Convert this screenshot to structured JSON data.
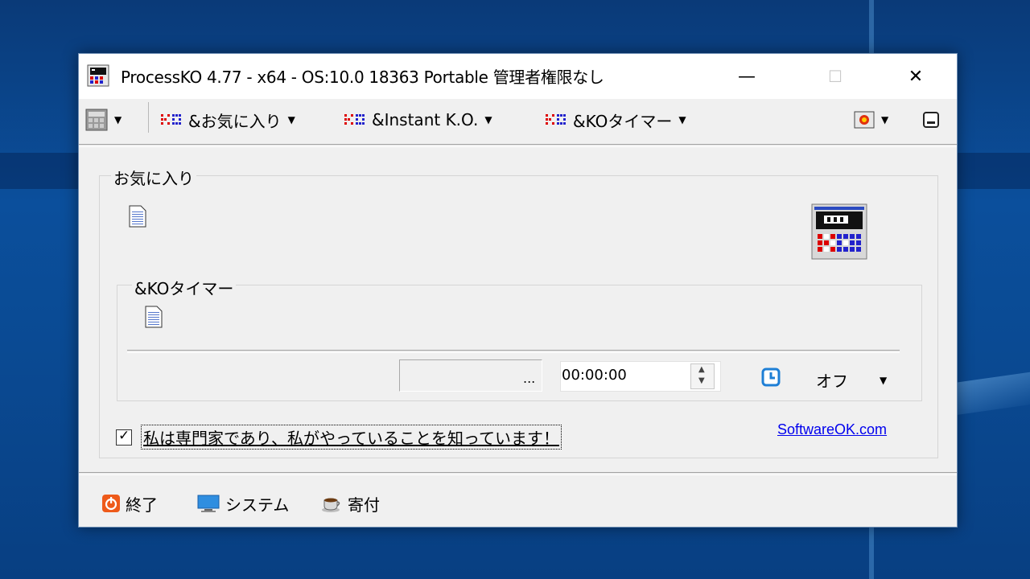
{
  "window": {
    "title": "ProcessKO 4.77 - x64  - OS:10.0 18363 Portable 管理者権限なし",
    "minimize": "—",
    "maximize": "☐",
    "close": "✕"
  },
  "toolbar": {
    "favorites_menu": "&お気に入り",
    "instant_menu": "&Instant K.O.",
    "timer_menu": "&KOタイマー"
  },
  "favorites_group": {
    "label": "お気に入り"
  },
  "timer_group": {
    "label": "&KOタイマー",
    "path_value": "...",
    "time_value": "00:00:00",
    "mode_value": "オフ"
  },
  "expert": {
    "checked": true,
    "label": "私は専門家であり、私がやっていることを知っています！"
  },
  "link": {
    "text": "SoftwareOK.com"
  },
  "bottom": {
    "exit": "終了",
    "system": "システム",
    "donate": "寄付"
  },
  "icons": {
    "app": "processko-app-icon",
    "doc": "document-icon",
    "clock": "clock-icon",
    "exit": "power-icon",
    "system": "monitor-icon",
    "donate": "coffee-cup-icon"
  }
}
